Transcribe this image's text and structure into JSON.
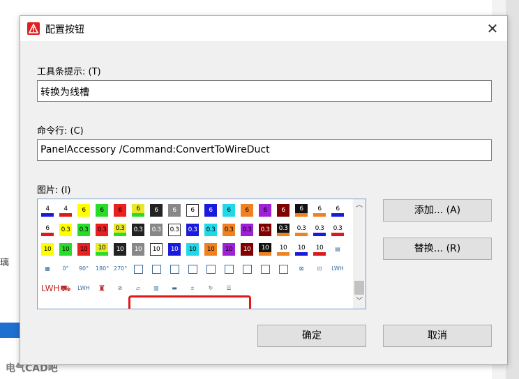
{
  "dialog": {
    "title": "配置按钮",
    "close_glyph": "✕",
    "tooltip_label": "工具条提示: (T)",
    "tooltip_value": "转换为线槽",
    "command_label": "命令行: (C)",
    "command_value": "PanelAccessory /Command:ConvertToWireDuct",
    "image_label": "图片: (I)",
    "add_button": "添加... (A)",
    "replace_button": "替换... (R)",
    "ok_button": "确定",
    "cancel_button": "取消"
  },
  "background": {
    "left_char": "璃",
    "watermark_logo": "eA",
    "watermark_text": "电气CAD吧"
  },
  "icon_rows": [
    [
      {
        "t": "4",
        "bg": "#ffffff",
        "fg": "#000000",
        "bar": "#1a1adc"
      },
      {
        "t": "4",
        "bg": "#ffffff",
        "fg": "#000000",
        "bar": "#dc1a1a"
      },
      {
        "t": "6",
        "bg": "#ffff00",
        "fg": "#000000"
      },
      {
        "t": "6",
        "bg": "#2adc2a",
        "fg": "#000000"
      },
      {
        "t": "6",
        "bg": "#e82020",
        "fg": "#000000"
      },
      {
        "t": "6",
        "bg": "#e8e82a",
        "fg": "#000000",
        "bar": "#2adc2a"
      },
      {
        "t": "6",
        "bg": "#222222",
        "fg": "#ffffff"
      },
      {
        "t": "6",
        "bg": "#888888",
        "fg": "#ffffff"
      },
      {
        "t": "6",
        "bg": "#ffffff",
        "fg": "#000000",
        "outline": true
      },
      {
        "t": "6",
        "bg": "#1a1adc",
        "fg": "#ffffff"
      },
      {
        "t": "6",
        "bg": "#20d8e8",
        "fg": "#000000"
      },
      {
        "t": "6",
        "bg": "#f08020",
        "fg": "#000000"
      },
      {
        "t": "6",
        "bg": "#a020d8",
        "fg": "#000000"
      },
      {
        "t": "6",
        "bg": "#800000",
        "fg": "#ffffff"
      },
      {
        "t": "6",
        "bg": "#111111",
        "fg": "#ffffff",
        "bar": "#f08020"
      },
      {
        "t": "6",
        "bg": "#ffffff",
        "fg": "#000000",
        "bar": "#f08020"
      },
      {
        "t": "6",
        "bg": "#ffffff",
        "fg": "#000000",
        "bar": "#1a1adc"
      }
    ],
    [
      {
        "t": "6",
        "bg": "#ffffff",
        "fg": "#000000",
        "bar": "#dc1a1a"
      },
      {
        "t": "0.3",
        "bg": "#ffff00",
        "fg": "#000000"
      },
      {
        "t": "0.3",
        "bg": "#2adc2a",
        "fg": "#000000"
      },
      {
        "t": "0.3",
        "bg": "#e82020",
        "fg": "#000000"
      },
      {
        "t": "0.3",
        "bg": "#e8e82a",
        "fg": "#000000",
        "bar": "#2adc2a"
      },
      {
        "t": "0.3",
        "bg": "#222222",
        "fg": "#ffffff"
      },
      {
        "t": "0.3",
        "bg": "#888888",
        "fg": "#ffffff"
      },
      {
        "t": "0.3",
        "bg": "#ffffff",
        "fg": "#000000",
        "outline": true
      },
      {
        "t": "0.3",
        "bg": "#1a1adc",
        "fg": "#ffffff"
      },
      {
        "t": "0.3",
        "bg": "#20d8e8",
        "fg": "#000000"
      },
      {
        "t": "0.3",
        "bg": "#f08020",
        "fg": "#000000"
      },
      {
        "t": "0.3",
        "bg": "#a020d8",
        "fg": "#000000"
      },
      {
        "t": "0.3",
        "bg": "#800000",
        "fg": "#ffffff"
      },
      {
        "t": "0.3",
        "bg": "#111111",
        "fg": "#ffffff",
        "bar": "#f08020"
      },
      {
        "t": "0.3",
        "bg": "#ffffff",
        "fg": "#000000",
        "bar": "#f08020"
      },
      {
        "t": "0.3",
        "bg": "#ffffff",
        "fg": "#000000",
        "bar": "#1a1adc"
      },
      {
        "t": "0.3",
        "bg": "#ffffff",
        "fg": "#000000",
        "bar": "#dc1a1a"
      }
    ],
    [
      {
        "t": "10",
        "bg": "#ffff00",
        "fg": "#000000"
      },
      {
        "t": "10",
        "bg": "#2adc2a",
        "fg": "#000000"
      },
      {
        "t": "10",
        "bg": "#e82020",
        "fg": "#000000"
      },
      {
        "t": "10",
        "bg": "#e8e82a",
        "fg": "#000000",
        "bar": "#2adc2a"
      },
      {
        "t": "10",
        "bg": "#222222",
        "fg": "#ffffff"
      },
      {
        "t": "10",
        "bg": "#888888",
        "fg": "#ffffff"
      },
      {
        "t": "10",
        "bg": "#ffffff",
        "fg": "#000000",
        "outline": true
      },
      {
        "t": "10",
        "bg": "#1a1adc",
        "fg": "#ffffff"
      },
      {
        "t": "10",
        "bg": "#20d8e8",
        "fg": "#000000"
      },
      {
        "t": "10",
        "bg": "#f08020",
        "fg": "#000000"
      },
      {
        "t": "10",
        "bg": "#a020d8",
        "fg": "#000000"
      },
      {
        "t": "10",
        "bg": "#800000",
        "fg": "#ffffff"
      },
      {
        "t": "10",
        "bg": "#111111",
        "fg": "#ffffff",
        "bar": "#f08020"
      },
      {
        "t": "10",
        "bg": "#ffffff",
        "fg": "#000000",
        "bar": "#f08020"
      },
      {
        "t": "10",
        "bg": "#ffffff",
        "fg": "#000000",
        "bar": "#1a1adc"
      },
      {
        "t": "10",
        "bg": "#ffffff",
        "fg": "#000000",
        "bar": "#dc1a1a"
      },
      {
        "sym": "▤",
        "cls": ""
      }
    ],
    [
      {
        "sym": "▦",
        "cls": ""
      },
      {
        "sym": "0°",
        "cls": ""
      },
      {
        "sym": "90°",
        "cls": ""
      },
      {
        "sym": "180°",
        "cls": ""
      },
      {
        "sym": "270°",
        "cls": ""
      },
      {
        "sym": "",
        "cls": "box"
      },
      {
        "sym": "",
        "cls": "box"
      },
      {
        "sym": "",
        "cls": "box"
      },
      {
        "sym": "",
        "cls": "box"
      },
      {
        "sym": "",
        "cls": "box"
      },
      {
        "sym": "",
        "cls": "box"
      },
      {
        "sym": "",
        "cls": "box"
      },
      {
        "sym": "",
        "cls": "box"
      },
      {
        "sym": "",
        "cls": "box"
      },
      {
        "sym": "⊠",
        "cls": ""
      },
      {
        "sym": "⊡",
        "cls": ""
      },
      {
        "sym": "LWH",
        "cls": ""
      }
    ],
    [
      {
        "sym": "LWH",
        "cls": "redcart"
      },
      {
        "sym": "⛟",
        "cls": "redcart"
      },
      {
        "sym": "LWH",
        "cls": ""
      },
      {
        "sym": "♜",
        "cls": "redcart"
      },
      {
        "sym": "⊘",
        "cls": ""
      },
      {
        "sym": "▱",
        "cls": ""
      },
      {
        "sym": "▥",
        "cls": ""
      },
      {
        "sym": "▬",
        "cls": ""
      },
      {
        "sym": "⩧",
        "cls": ""
      },
      {
        "sym": "↻",
        "cls": ""
      },
      {
        "sym": "☰",
        "cls": ""
      }
    ]
  ]
}
